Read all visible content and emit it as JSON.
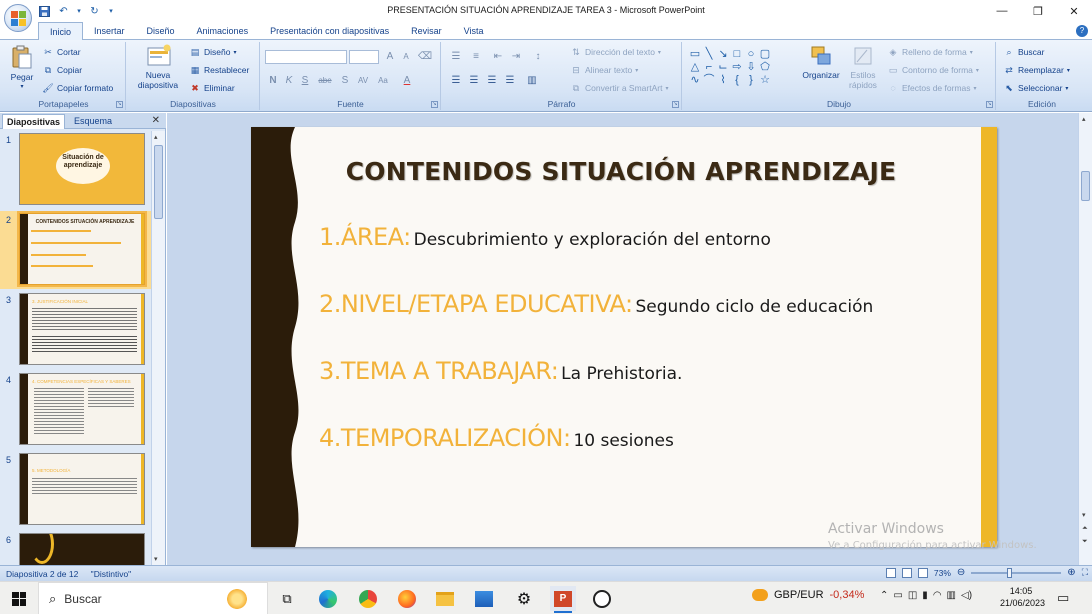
{
  "window": {
    "title": "PRESENTACIÓN SITUACIÓN APRENDIZAJE TAREA 3 - Microsoft PowerPoint",
    "controls": [
      "minimize-icon",
      "restore-icon",
      "close-icon"
    ]
  },
  "ribbon_tabs": [
    "Inicio",
    "Insertar",
    "Diseño",
    "Animaciones",
    "Presentación con diapositivas",
    "Revisar",
    "Vista"
  ],
  "active_tab": "Inicio",
  "ribbon": {
    "portapapeles": {
      "label": "Portapapeles",
      "paste": "Pegar",
      "cut": "Cortar",
      "copy": "Copiar",
      "format_painter": "Copiar formato"
    },
    "diapositivas": {
      "label": "Diapositivas",
      "new_slide": "Nueva diapositiva",
      "layout": "Diseño",
      "reset": "Restablecer",
      "delete": "Eliminar"
    },
    "fuente": {
      "label": "Fuente",
      "bold": "N",
      "italic": "K",
      "underline": "S",
      "strike": "abe"
    },
    "parrafo": {
      "label": "Párrafo",
      "text_direction": "Dirección del texto",
      "align_text": "Alinear texto",
      "smartart": "Convertir a SmartArt"
    },
    "dibujo": {
      "label": "Dibujo",
      "arrange": "Organizar",
      "quick_styles": "Estilos rápidos",
      "fill": "Relleno de forma",
      "outline": "Contorno de forma",
      "effects": "Efectos de formas"
    },
    "edicion": {
      "label": "Edición",
      "find": "Buscar",
      "replace": "Reemplazar",
      "select": "Seleccionar"
    }
  },
  "pane": {
    "tab_slides": "Diapositivas",
    "tab_outline": "Esquema"
  },
  "thumbnails": [
    {
      "num": "1",
      "title": "Situación de aprendizaje"
    },
    {
      "num": "2",
      "title": "CONTENIDOS SITUACIÓN APRENDIZAJE"
    },
    {
      "num": "3",
      "title": "3. JUSTIFICACIÓN INICIAL"
    },
    {
      "num": "4",
      "title": "4. COMPETENCIAS ESPECÍFICAS Y SABERES"
    },
    {
      "num": "5",
      "title": "5. METODOLOGÍA"
    },
    {
      "num": "6",
      "title": ""
    }
  ],
  "slide": {
    "title": "CONTENIDOS SITUACIÓN APRENDIZAJE",
    "items": [
      {
        "label": "1.ÁREA:",
        "value": "Descubrimiento y exploración del entorno"
      },
      {
        "label": "2.NIVEL/ETAPA EDUCATIVA:",
        "value": "Segundo ciclo de educación"
      },
      {
        "label": "3.TEMA A TRABAJAR:",
        "value": "La Prehistoria."
      },
      {
        "label": "4.TEMPORALIZACIÓN:",
        "value": "10 sesiones"
      }
    ],
    "colors": {
      "accent": "#f2b23a",
      "strip": "#eeb728",
      "band": "#2b1c0a",
      "title": "#3b2a14"
    }
  },
  "watermark": {
    "line1": "Activar Windows",
    "line2": "Ve a Configuración para activar Windows."
  },
  "status": {
    "slide_info": "Diapositiva 2 de 12",
    "theme": "\"Distintivo\"",
    "zoom": "73%"
  },
  "taskbar": {
    "search_placeholder": "Buscar",
    "ticker_symbol": "GBP/EUR",
    "ticker_change": "-0,34%",
    "time": "14:05",
    "date": "21/06/2023"
  }
}
